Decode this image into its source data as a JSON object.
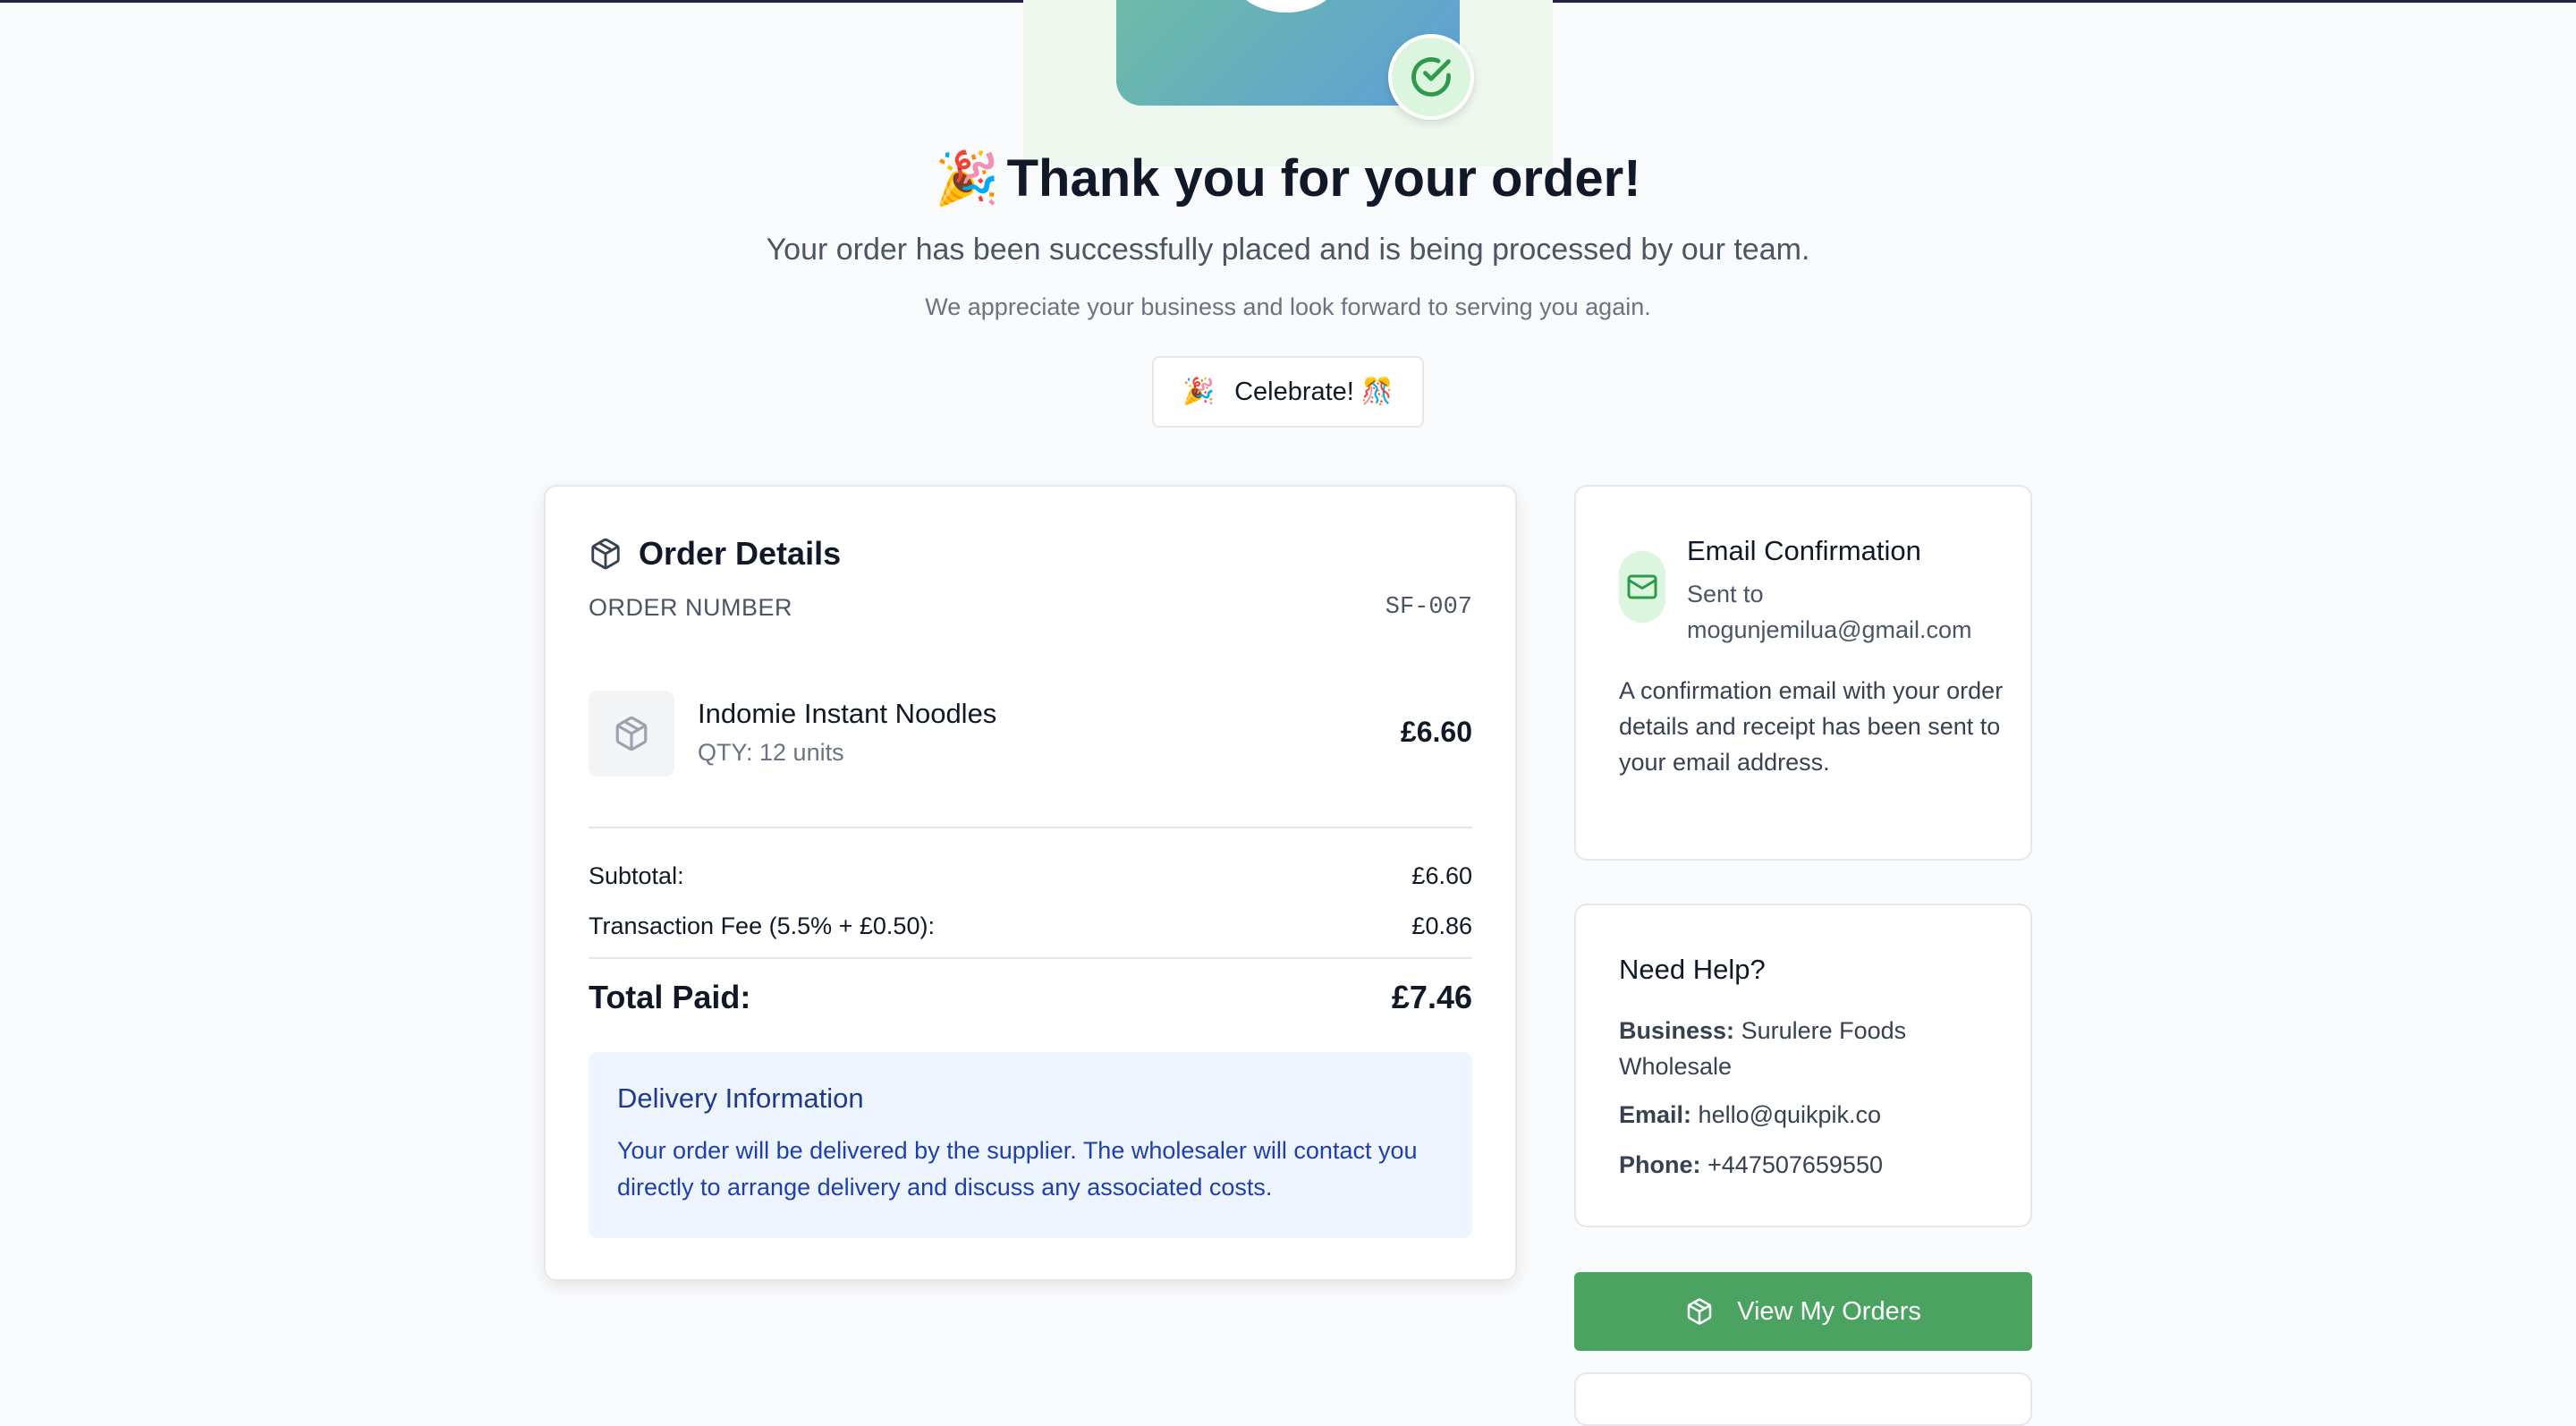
{
  "hero": {
    "title": "Thank you for your order!",
    "title_emoji": "🎉",
    "subtitle": "Your order has been successfully placed and is being processed by our team.",
    "note": "We appreciate your business and look forward to serving you again.",
    "celebrate_label": "Celebrate! 🎊",
    "celebrate_icon": "🎉"
  },
  "order": {
    "title": "Order Details",
    "number_label": "ORDER NUMBER",
    "number_value": "SF-007",
    "item": {
      "name": "Indomie Instant Noodles",
      "qty": "QTY: 12 units",
      "price": "£6.60"
    },
    "subtotal_label": "Subtotal:",
    "subtotal_value": "£6.60",
    "fee_label": "Transaction Fee (5.5% + £0.50):",
    "fee_value": "£0.86",
    "total_label": "Total Paid:",
    "total_value": "£7.46",
    "delivery": {
      "title": "Delivery Information",
      "text": "Your order will be delivered by the supplier. The wholesaler will contact you directly to arrange delivery and discuss any associated costs."
    }
  },
  "email": {
    "title": "Email Confirmation",
    "sent_to_label": "Sent to",
    "address": "mogunjemilua@gmail.com",
    "body": "A confirmation email with your order details and receipt has been sent to your email address."
  },
  "help": {
    "title": "Need Help?",
    "business_label": "Business:",
    "business_value": "Surulere Foods Wholesale",
    "email_label": "Email:",
    "email_value": "hello@quikpik.co",
    "phone_label": "Phone:",
    "phone_value": "+447507659550"
  },
  "actions": {
    "view_orders_label": "View My Orders"
  },
  "colors": {
    "primary_green": "#4aa361",
    "success_light": "#dcf5df",
    "delivery_bg": "#eef4fd",
    "delivery_text": "#1e40af"
  }
}
